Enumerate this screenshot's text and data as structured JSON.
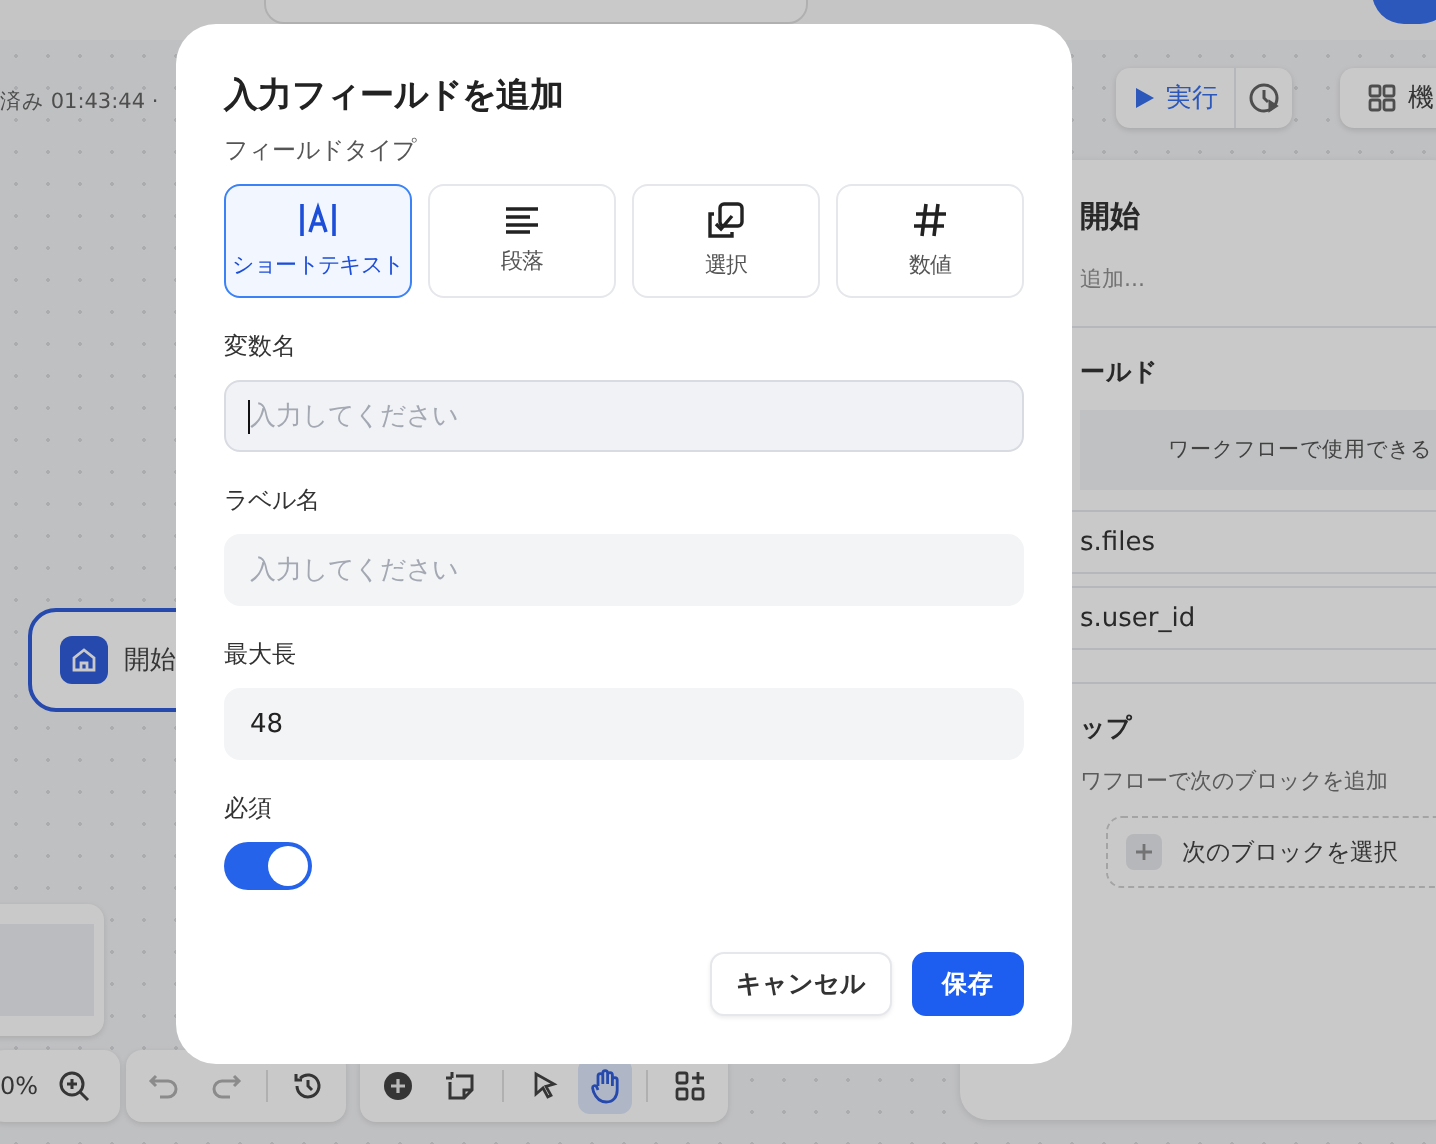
{
  "header": {
    "save_status": "済み 01:43:44 ·"
  },
  "run_toolbar": {
    "run_label": "実行"
  },
  "features_button": {
    "label": "機"
  },
  "side_panel": {
    "title": "開始",
    "description": "追加...",
    "fields_heading": "ールド",
    "fields_hint": "ワークフローで使用できる",
    "fields": [
      "s.files",
      "s.user_id"
    ],
    "next_heading": "ップ",
    "next_description": "ワフローで次のブロックを追加",
    "next_button": "次のブロックを選択"
  },
  "canvas": {
    "nodes": [
      {
        "label": "開始",
        "selected": true
      }
    ]
  },
  "zoom": {
    "reading": "0%"
  },
  "history_tools": [
    {
      "kind": "undo",
      "disabled": true
    },
    {
      "kind": "redo",
      "disabled": true
    },
    {
      "kind": "history",
      "disabled": false
    }
  ],
  "tools": [
    {
      "kind": "add",
      "selected": false
    },
    {
      "kind": "note",
      "selected": false
    },
    {
      "kind": "pointer",
      "selected": false
    },
    {
      "kind": "hand",
      "selected": true
    },
    {
      "kind": "blocks",
      "selected": false
    }
  ],
  "dialog": {
    "title": "入力フィールドを追加",
    "type_label": "フィールドタイプ",
    "types": [
      {
        "kind": "short_text",
        "label": "ショートテキスト",
        "selected": true
      },
      {
        "kind": "paragraph",
        "label": "段落",
        "selected": false
      },
      {
        "kind": "select",
        "label": "選択",
        "selected": false
      },
      {
        "kind": "number",
        "label": "数値",
        "selected": false
      }
    ],
    "fields": [
      {
        "label": "変数名",
        "placeholder": "入力してください",
        "focused": true
      },
      {
        "label": "ラベル名",
        "placeholder": "入力してください",
        "focused": false
      },
      {
        "label": "最大長",
        "value": "48",
        "focused": false
      }
    ],
    "required": {
      "label": "必須",
      "on": true
    },
    "buttons": [
      {
        "kind": "secondary",
        "label": "キャンセル"
      },
      {
        "kind": "primary",
        "label": "保存"
      }
    ]
  }
}
